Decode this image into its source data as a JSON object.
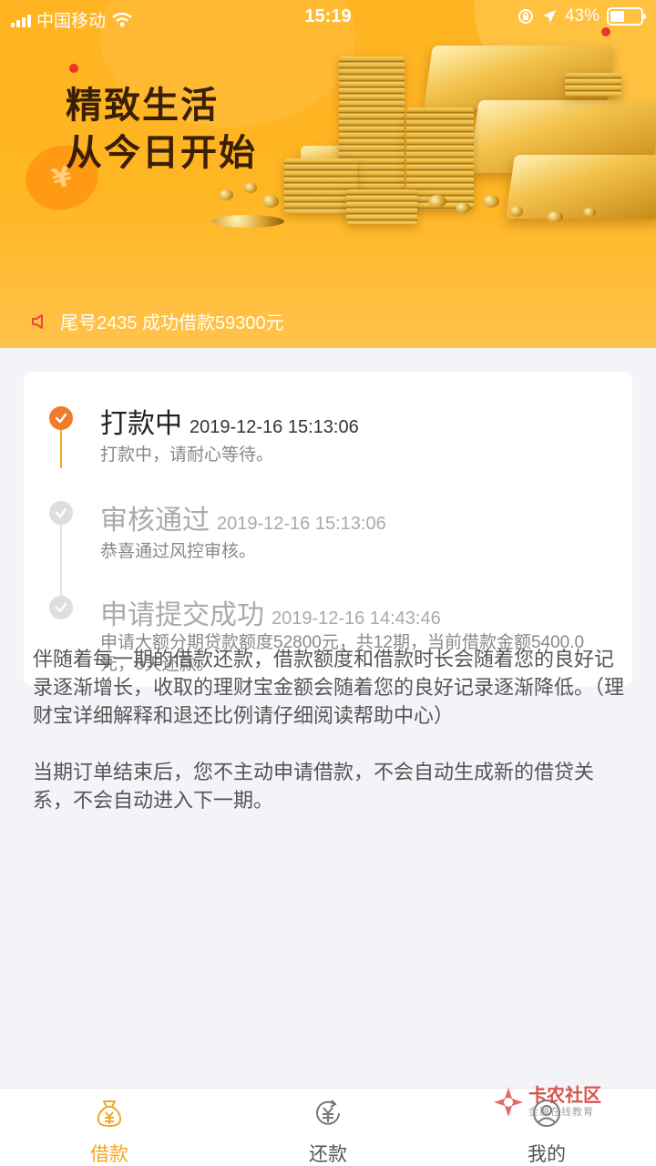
{
  "status_bar": {
    "carrier": "中国移动",
    "time": "15:19",
    "battery": "43%"
  },
  "banner": {
    "slogan_line1": "精致生活",
    "slogan_line2": "从今日开始",
    "currency_symbol": "¥",
    "notice": "尾号2435 成功借款59300元"
  },
  "timeline": [
    {
      "title": "打款中",
      "time": "2019-12-16 15:13:06",
      "desc": "打款中，请耐心等待。",
      "state": "active"
    },
    {
      "title": "审核通过",
      "time": "2019-12-16 15:13:06",
      "desc": "恭喜通过风控审核。",
      "state": "done"
    },
    {
      "title": "申请提交成功",
      "time": "2019-12-16 14:43:46",
      "desc": "申请大额分期贷款额度52800元，共12期，当前借款金额5400.0元，6天还款。",
      "state": "done"
    }
  ],
  "explanation": {
    "paragraph1": "伴随着每一期的借款还款，借款额度和借款时长会随着您的良好记录逐渐增长，收取的理财宝金额会随着您的良好记录逐渐降低。（理财宝详细解释和退还比例请仔细阅读帮助中心）",
    "paragraph2": "当期订单结束后，您不主动申请借款，不会自动生成新的借贷关系，不会自动进入下一期。"
  },
  "tabs": [
    {
      "label": "借款",
      "icon": "money-bag-icon",
      "active": true
    },
    {
      "label": "还款",
      "icon": "repay-yen-icon",
      "active": false
    },
    {
      "label": "我的",
      "icon": "profile-icon",
      "active": false
    }
  ],
  "watermark": {
    "text": "卡农社区",
    "sub": "金融在线教育"
  },
  "colors": {
    "accent": "#f5a623",
    "active_step": "#f07c2a",
    "done_step": "#d9d9d9",
    "banner": "#ffb321"
  }
}
